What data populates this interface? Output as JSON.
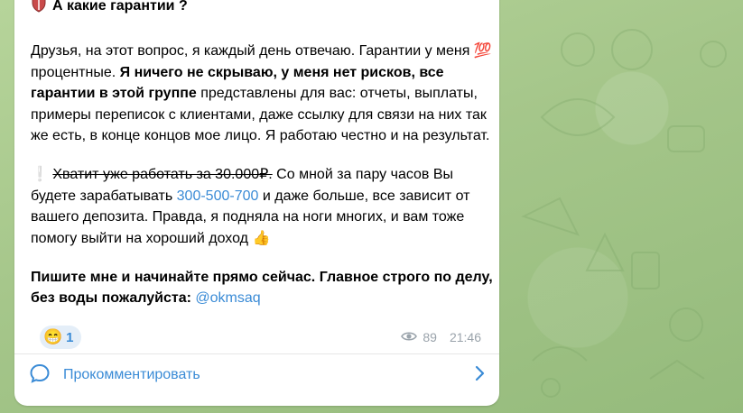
{
  "post": {
    "title": "А какие гарантии ?",
    "title_icon": "shield-icon",
    "para1": {
      "normal1": "Друзья, на этот вопрос, я каждый день отвечаю. Гарантии у меня ",
      "emoji": "💯",
      "normal2": " процентные. ",
      "bold": "Я ничего не скрываю, у меня нет рисков, все гарантии в этой группе",
      "normal3": " представлены для вас: отчеты, выплаты, примеры переписок с клиентами, даже ссылку для связи на них так же есть, в конце концов мое лицо. Я работаю честно и на результат."
    },
    "para2": {
      "emoji": "❕",
      "strike": "Хватит уже работать за 30.000₽.",
      "normal1": " Со мной за пару часов Вы будете зарабатывать ",
      "link": "300-500-700",
      "normal2": " и даже больше, все зависит от вашего депозита. Правда, я подняла на ноги многих, и вам тоже помогу выйти на хороший доход ",
      "emoji_end": "👍"
    },
    "para3": {
      "bold": "Пишите мне и начинайте прямо сейчас. Главное строго по делу, без воды пожалуйста: ",
      "mention": "@okmsaq"
    },
    "reaction": {
      "emoji": "😁",
      "count": "1"
    },
    "views": "89",
    "time": "21:46",
    "comment_label": "Прокомментировать"
  },
  "colors": {
    "accent": "#3a8bd6",
    "background": "#a9c98d",
    "bubble": "#ffffff",
    "meta": "#9aa3ab"
  }
}
